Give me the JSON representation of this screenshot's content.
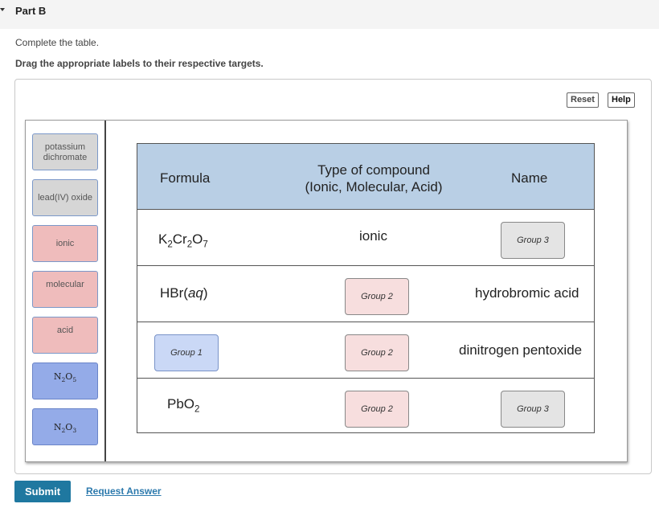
{
  "part": {
    "title": "Part B"
  },
  "instructions": {
    "line1": "Complete the table.",
    "line2": "Drag the appropriate labels to their respective targets."
  },
  "toolbar": {
    "reset_label": "Reset",
    "help_label": "Help"
  },
  "labels": {
    "potassium_dichromate": "potassium dichromate",
    "lead_oxide": "lead(IV) oxide",
    "ionic": "ionic",
    "molecular": "molecular",
    "acid": "acid",
    "n2o5": {
      "n1": "N",
      "s1": "2",
      "n2": "O",
      "s2": "5"
    },
    "n2o3": {
      "n1": "N",
      "s1": "2",
      "n2": "O",
      "s2": "3"
    }
  },
  "table": {
    "headers": {
      "formula": "Formula",
      "type_line1": "Type of compound",
      "type_line2": "(Ionic, Molecular, Acid)",
      "name": "Name"
    },
    "rows": [
      {
        "formula": {
          "a": "K",
          "sa": "2",
          "b": "Cr",
          "sb": "2",
          "c": "O",
          "sc": "7"
        },
        "type": "ionic",
        "name_target": "Group 3"
      },
      {
        "formula": {
          "main": "HBr",
          "paren_open": "(",
          "state": "aq",
          "paren_close": ")"
        },
        "type_target": "Group 2",
        "name": "hydrobromic acid"
      },
      {
        "formula_target": "Group 1",
        "type_target": "Group 2",
        "name": "dinitrogen pentoxide"
      },
      {
        "formula": {
          "a": "PbO",
          "sa": "2"
        },
        "type_target": "Group 2",
        "name_target": "Group 3"
      }
    ]
  },
  "actions": {
    "submit_label": "Submit",
    "request_label": "Request Answer"
  },
  "colors": {
    "header_bg": "#b9cfe5",
    "submit_bg": "#1f78a0",
    "link": "#2d7aad",
    "chip_gray": "#d6d6d6",
    "chip_pink": "#efbcbc",
    "chip_blue": "#94abe8"
  },
  "icons": {
    "collapse": "caret-down-icon"
  }
}
